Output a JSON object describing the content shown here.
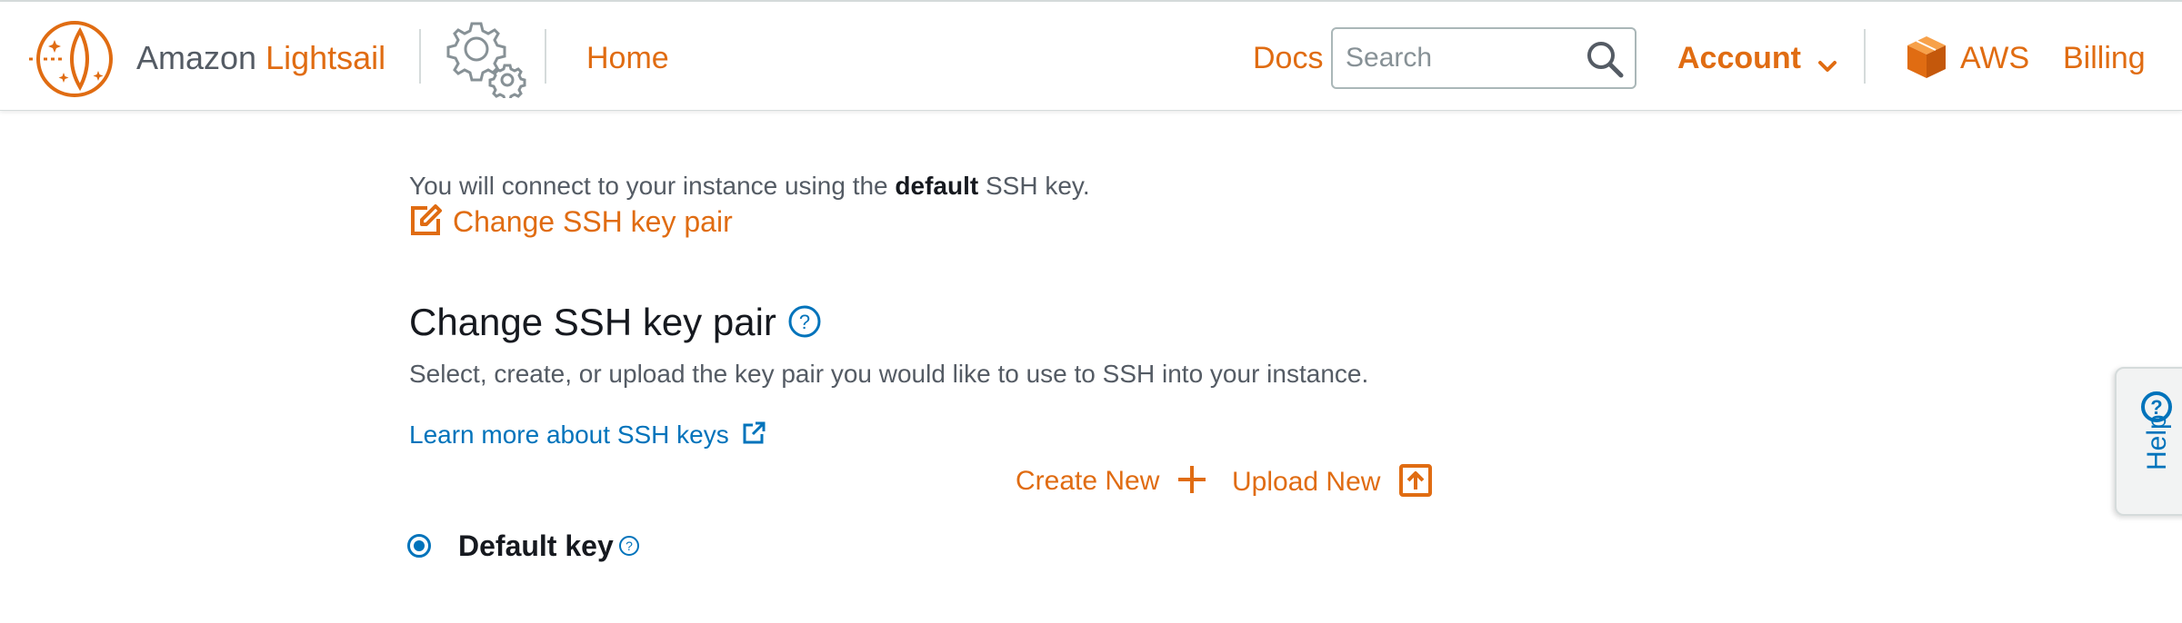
{
  "header": {
    "logo": {
      "brand": "Amazon",
      "product": "Lightsail",
      "icon": "lightsail-logo-icon"
    },
    "settings_icon": "gears-icon",
    "home_label": "Home",
    "docs_label": "Docs",
    "search": {
      "placeholder": "Search",
      "value": "",
      "icon": "search-icon"
    },
    "account_label": "Account",
    "aws_label": "AWS",
    "billing_label": "Billing"
  },
  "main": {
    "connect_prefix": "You will connect to your instance using the",
    "connect_bold": "default",
    "connect_suffix": "SSH key.",
    "change_link_label": "Change SSH key pair",
    "section_title": "Change SSH key pair",
    "section_description": "Select, create, or upload the key pair you would like to use to SSH into your instance.",
    "learn_more_label": "Learn more about SSH keys",
    "create_new_label": "Create New",
    "upload_new_label": "Upload New",
    "default_key_label": "Default key",
    "default_key_selected": true
  },
  "help_tab": {
    "label": "Help"
  },
  "colors": {
    "accent_orange": "#e06c12",
    "link_blue": "#0073bb",
    "text_gray": "#545b64",
    "text_dark": "#16191f",
    "border": "#d5dbdb"
  }
}
